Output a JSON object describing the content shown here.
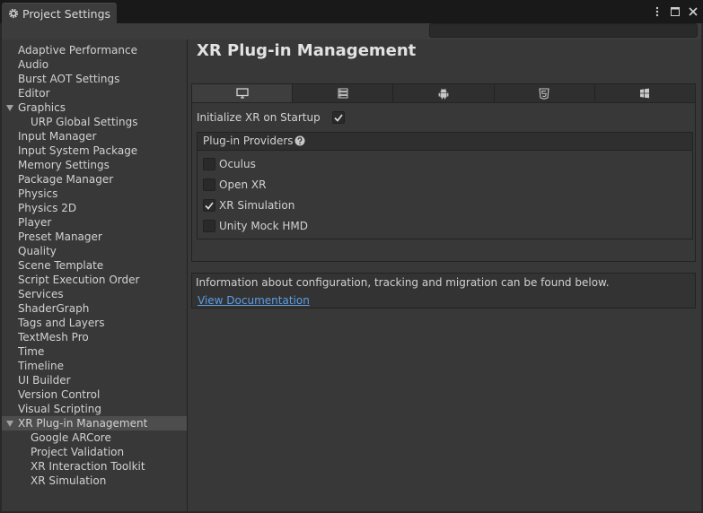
{
  "window": {
    "tab_title": "Project Settings",
    "tab_icon": "gear-icon"
  },
  "toolbar": {
    "search_placeholder": "",
    "search_value": ""
  },
  "sidebar": {
    "items": [
      {
        "label": "Adaptive Performance",
        "level": 0
      },
      {
        "label": "Audio",
        "level": 0
      },
      {
        "label": "Burst AOT Settings",
        "level": 0
      },
      {
        "label": "Editor",
        "level": 0
      },
      {
        "label": "Graphics",
        "level": 0,
        "expanded": true
      },
      {
        "label": "URP Global Settings",
        "level": 1
      },
      {
        "label": "Input Manager",
        "level": 0
      },
      {
        "label": "Input System Package",
        "level": 0
      },
      {
        "label": "Memory Settings",
        "level": 0
      },
      {
        "label": "Package Manager",
        "level": 0
      },
      {
        "label": "Physics",
        "level": 0
      },
      {
        "label": "Physics 2D",
        "level": 0
      },
      {
        "label": "Player",
        "level": 0
      },
      {
        "label": "Preset Manager",
        "level": 0
      },
      {
        "label": "Quality",
        "level": 0
      },
      {
        "label": "Scene Template",
        "level": 0
      },
      {
        "label": "Script Execution Order",
        "level": 0
      },
      {
        "label": "Services",
        "level": 0
      },
      {
        "label": "ShaderGraph",
        "level": 0
      },
      {
        "label": "Tags and Layers",
        "level": 0
      },
      {
        "label": "TextMesh Pro",
        "level": 0
      },
      {
        "label": "Time",
        "level": 0
      },
      {
        "label": "Timeline",
        "level": 0
      },
      {
        "label": "UI Builder",
        "level": 0
      },
      {
        "label": "Version Control",
        "level": 0
      },
      {
        "label": "Visual Scripting",
        "level": 0
      },
      {
        "label": "XR Plug-in Management",
        "level": 0,
        "expanded": true,
        "selected": true
      },
      {
        "label": "Google ARCore",
        "level": 1
      },
      {
        "label": "Project Validation",
        "level": 1
      },
      {
        "label": "XR Interaction Toolkit",
        "level": 1
      },
      {
        "label": "XR Simulation",
        "level": 1
      }
    ]
  },
  "main": {
    "title": "XR Plug-in Management",
    "platform_tabs": [
      {
        "icon": "desktop-icon",
        "active": true
      },
      {
        "icon": "server-icon",
        "active": false
      },
      {
        "icon": "android-icon",
        "active": false
      },
      {
        "icon": "html5-icon",
        "active": false
      },
      {
        "icon": "windows-icon",
        "active": false
      }
    ],
    "init_xr_label": "Initialize XR on Startup",
    "init_xr_checked": true,
    "providers": {
      "title": "Plug-in Providers",
      "items": [
        {
          "label": "Oculus",
          "checked": false
        },
        {
          "label": "Open XR",
          "checked": false
        },
        {
          "label": "XR Simulation",
          "checked": true
        },
        {
          "label": "Unity Mock HMD",
          "checked": false
        }
      ]
    },
    "info": {
      "text": "Information about configuration, tracking and migration can be found below.",
      "link": "View Documentation"
    }
  },
  "colors": {
    "background": "#383838",
    "selected": "#4d4d4d",
    "link": "#5c9ee6",
    "text": "#d2d2d2"
  }
}
